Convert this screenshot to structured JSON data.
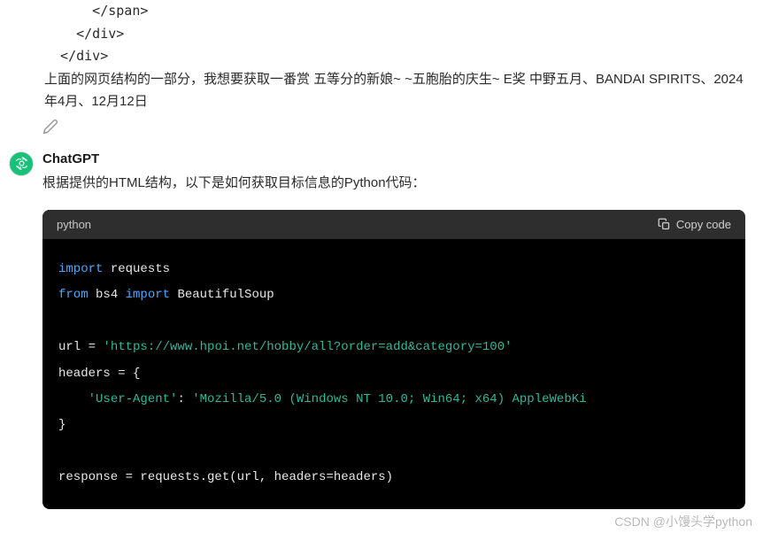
{
  "user_message": {
    "code_line1": "      </span>",
    "code_line2": "    </div>",
    "code_line3": "  </div>",
    "text": "上面的网页结构的一部分，我想要获取一番赏 五等分的新娘~ ~五胞胎的庆生~ E奖 中野五月、BANDAI SPIRITS、2024年4月、12月12日"
  },
  "assistant": {
    "name": "ChatGPT",
    "reply": "根据提供的HTML结构，以下是如何获取目标信息的Python代码："
  },
  "code": {
    "language": "python",
    "copy_label": "Copy code",
    "lines": {
      "l1_kw1": "import",
      "l1_id": " requests",
      "l2_kw1": "from",
      "l2_id1": " bs4 ",
      "l2_kw2": "import",
      "l2_id2": " BeautifulSoup",
      "l3_pre": "url = ",
      "l3_str": "'https://www.hpoi.net/hobby/all?order=add&category=100'",
      "l4": "headers = {",
      "l5_indent": "    ",
      "l5_key": "'User-Agent'",
      "l5_sep": ": ",
      "l5_val": "'Mozilla/5.0 (Windows NT 10.0; Win64; x64) AppleWebKi",
      "l6": "}",
      "l7": "response = requests.get(url, headers=headers)"
    }
  },
  "watermark": "CSDN @小馒头学python"
}
